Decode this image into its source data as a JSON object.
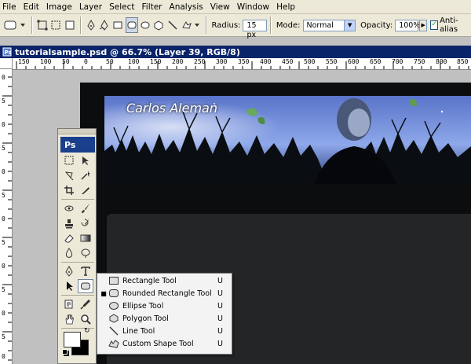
{
  "menubar": {
    "items": [
      "File",
      "Edit",
      "Image",
      "Layer",
      "Select",
      "Filter",
      "Analysis",
      "View",
      "Window",
      "Help"
    ]
  },
  "options": {
    "radius_label": "Radius:",
    "radius_value": "15 px",
    "mode_label": "Mode:",
    "mode_value": "Normal",
    "opacity_label": "Opacity:",
    "opacity_value": "100%",
    "antialias_label": "Anti-alias",
    "antialias_checked": true
  },
  "document": {
    "title": "tutorialsample.psd @ 66.7% (Layer 39, RGB/8)"
  },
  "ruler": {
    "top_ticks": [
      "150",
      "100",
      "50",
      "0",
      "50",
      "100",
      "150",
      "200",
      "250",
      "300",
      "350",
      "400",
      "450",
      "500",
      "550",
      "600",
      "650",
      "700",
      "750",
      "800",
      "850"
    ],
    "left_ticks": [
      "0",
      "5",
      "0",
      "5",
      "0",
      "5",
      "0",
      "5",
      "0",
      "5",
      "0",
      "5",
      "0",
      "5",
      "0"
    ]
  },
  "banner": {
    "name_text": "Carlos Aleman"
  },
  "toolbox": {
    "logo": "Ps"
  },
  "flyout": {
    "items": [
      {
        "label": "Rectangle Tool",
        "key": "U",
        "icon": "rectangle-icon",
        "selected": false
      },
      {
        "label": "Rounded Rectangle Tool",
        "key": "U",
        "icon": "rounded-rectangle-icon",
        "selected": true
      },
      {
        "label": "Ellipse Tool",
        "key": "U",
        "icon": "ellipse-icon",
        "selected": false
      },
      {
        "label": "Polygon Tool",
        "key": "U",
        "icon": "polygon-icon",
        "selected": false
      },
      {
        "label": "Line Tool",
        "key": "U",
        "icon": "line-icon",
        "selected": false
      },
      {
        "label": "Custom Shape Tool",
        "key": "U",
        "icon": "custom-shape-icon",
        "selected": false
      }
    ]
  },
  "colors": {
    "title_bar": "#0a246a",
    "chrome": "#ece9d8",
    "banner_sky": "#6f8fd6",
    "panel": "#232526"
  }
}
